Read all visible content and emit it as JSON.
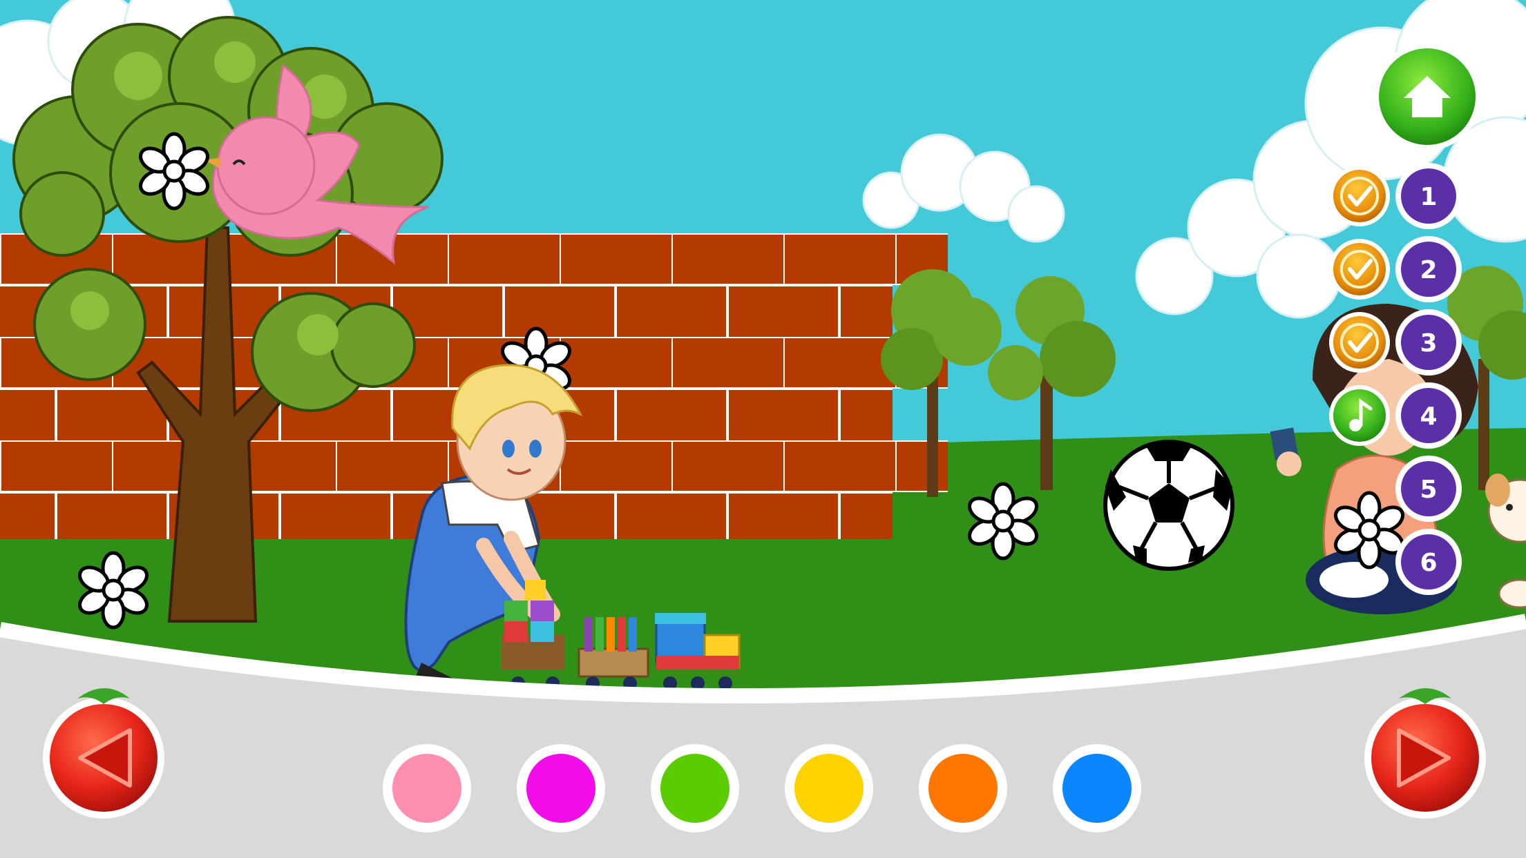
{
  "game": {
    "title": "",
    "palette": [
      {
        "name": "pink",
        "color": "#FF8FB1"
      },
      {
        "name": "magenta",
        "color": "#F20CE8"
      },
      {
        "name": "green",
        "color": "#5BCB02"
      },
      {
        "name": "yellow",
        "color": "#FFD200"
      },
      {
        "name": "orange",
        "color": "#FF7700"
      },
      {
        "name": "blue",
        "color": "#0A86FF"
      }
    ],
    "levels": [
      {
        "label": "1",
        "status": "completed"
      },
      {
        "label": "2",
        "status": "completed"
      },
      {
        "label": "3",
        "status": "completed"
      },
      {
        "label": "4",
        "status": "current"
      },
      {
        "label": "5",
        "status": "locked"
      },
      {
        "label": "6",
        "status": "locked"
      }
    ],
    "icons": {
      "home": "home-icon",
      "prev": "tomato-prev-arrow-icon",
      "next": "tomato-next-arrow-icon",
      "check": "checkmark-icon",
      "music": "music-note-icon"
    },
    "colors": {
      "sky": "#44C9D8",
      "grass": "#2F8F17",
      "brick": "#B33A00",
      "panel": "#D9D9D9",
      "level_badge": "#5A2FA8",
      "home_button": "#3BBF1A"
    }
  }
}
